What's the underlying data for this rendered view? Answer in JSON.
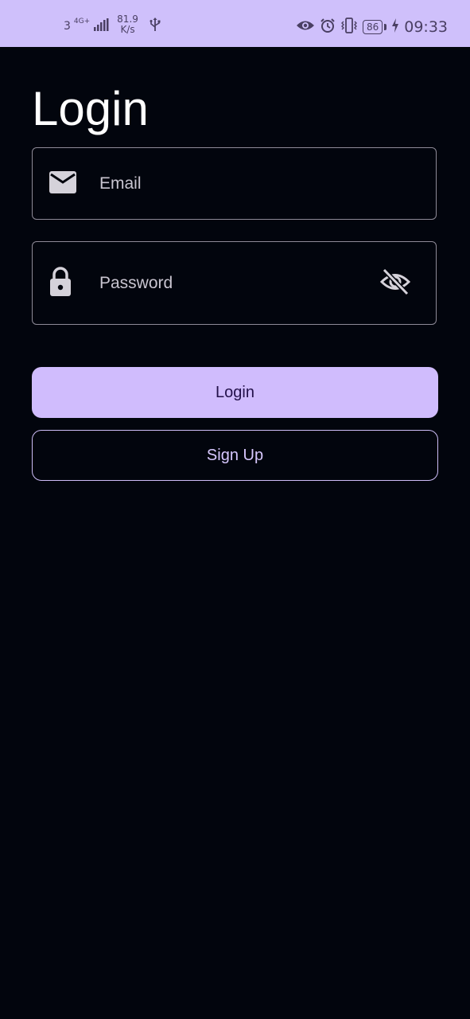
{
  "status_bar": {
    "signal_prefix": "3",
    "network_type": "4G+",
    "speed_value": "81.9",
    "speed_unit": "K/s",
    "battery_level": "86",
    "time": "09:33",
    "icons": [
      "usb-icon",
      "eye-icon",
      "alarm-icon",
      "vibrate-icon",
      "battery-icon",
      "charging-icon"
    ]
  },
  "page": {
    "title": "Login"
  },
  "form": {
    "email": {
      "placeholder": "Email",
      "icon": "mail-icon"
    },
    "password": {
      "placeholder": "Password",
      "icon": "lock-icon",
      "toggle_icon": "visibility-off-icon"
    }
  },
  "actions": {
    "login_label": "Login",
    "signup_label": "Sign Up"
  },
  "colors": {
    "background": "#02050d",
    "status_bar": "#cfc0fb",
    "primary": "#d0bcfd",
    "outline": "#8e8a97"
  }
}
